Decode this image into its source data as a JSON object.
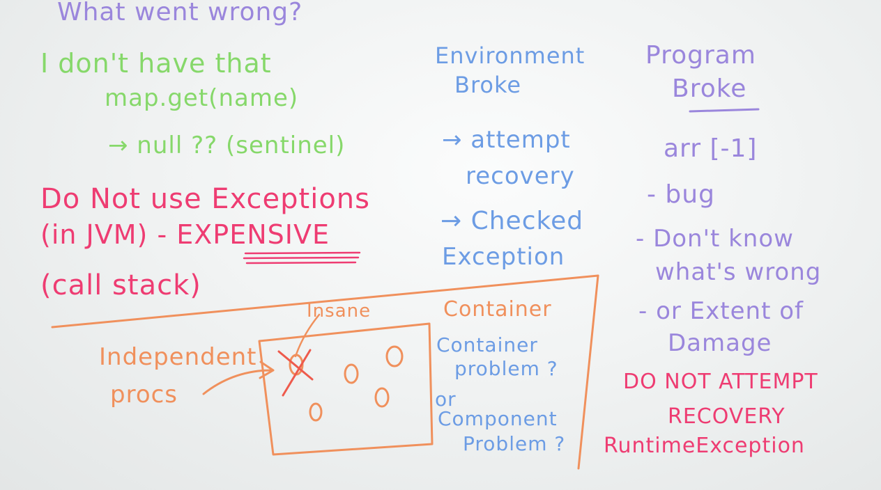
{
  "whiteboard": {
    "title": "What went wrong?",
    "left": {
      "no_value_heading": "I don't have that",
      "map_get": "map.get(name)",
      "null_sentinel": "→ null ?? (sentinel)",
      "no_exceptions_line1": "Do Not use Exceptions",
      "no_exceptions_line2_a": "(in JVM) - ",
      "no_exceptions_line2_b": "EXPENSIVE",
      "call_stack": "(call stack)"
    },
    "middle": {
      "env_heading_line1": "Environment",
      "env_heading_line2": "Broke",
      "attempt_recovery_line1": "→ attempt",
      "attempt_recovery_line2": "recovery",
      "checked_exception_line1": "→ Checked",
      "checked_exception_line2": "Exception"
    },
    "right": {
      "program_heading_line1": "Program",
      "program_heading_line2": "Broke",
      "arr_example": "arr [-1]",
      "bug": "- bug",
      "dont_know_line1": "- Don't know",
      "dont_know_line2": "what's wrong",
      "extent_line1": "- or Extent of",
      "extent_line2": "Damage",
      "do_not_attempt": "DO NOT ATTEMPT",
      "recovery": "RECOVERY",
      "runtime_exception": "RuntimeException"
    },
    "container_box": {
      "insane": "Insane",
      "independent_line1": "Independent",
      "independent_line2": "procs",
      "container_label": "Container",
      "container_problem_line1": "Container",
      "container_problem_line2": "problem ?",
      "or": "or",
      "component_problem_line1": "Component",
      "component_problem_line2": "Problem ?"
    }
  }
}
